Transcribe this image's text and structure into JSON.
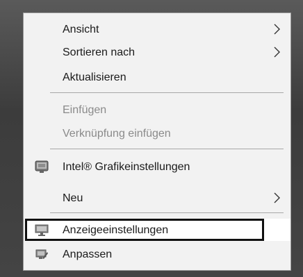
{
  "menu": {
    "items": [
      {
        "label": "Ansicht",
        "submenu": true
      },
      {
        "label": "Sortieren nach",
        "submenu": true
      },
      {
        "label": "Aktualisieren"
      },
      {
        "label": "Einfügen",
        "disabled": true
      },
      {
        "label": "Verknüpfung einfügen",
        "disabled": true
      },
      {
        "label": "Intel® Grafikeinstellungen",
        "icon": "intel-graphics-icon"
      },
      {
        "label": "Neu",
        "submenu": true
      },
      {
        "label": "Anzeigeeinstellungen",
        "icon": "display-icon",
        "highlighted": true
      },
      {
        "label": "Anpassen",
        "icon": "personalize-icon"
      }
    ]
  },
  "colors": {
    "menu_bg": "#f2f2f2",
    "disabled_text": "#8a8a8a",
    "highlight_border": "#111111"
  }
}
